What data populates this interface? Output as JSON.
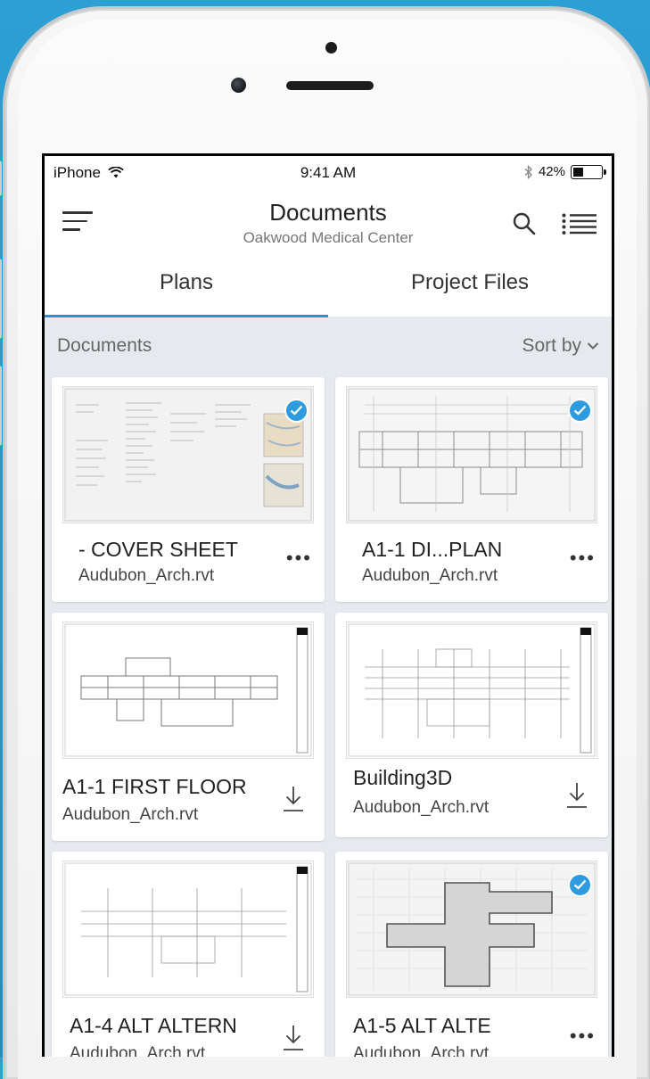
{
  "status_bar": {
    "carrier": "iPhone",
    "time": "9:41 AM",
    "battery": "42%",
    "battery_level": 0.42
  },
  "header": {
    "title": "Documents",
    "subtitle": "Oakwood Medical Center"
  },
  "tabs": [
    {
      "label": "Plans",
      "active": true
    },
    {
      "label": "Project Files",
      "active": false
    }
  ],
  "section": {
    "title": "Documents",
    "sort_label": "Sort by"
  },
  "cards": [
    {
      "name": "- COVER SHEET",
      "file": "Audubon_Arch.rvt",
      "action": "more",
      "checked": true
    },
    {
      "name": "A1-1 DI...PLAN",
      "file": "Audubon_Arch.rvt",
      "action": "more",
      "checked": true
    },
    {
      "name": "A1-1 FIRST FLOOR",
      "file": "Audubon_Arch.rvt",
      "action": "download",
      "checked": false
    },
    {
      "name": "Building3D",
      "file": "Audubon_Arch.rvt",
      "action": "download",
      "checked": false
    },
    {
      "name": "A1-4 ALT ALTERN",
      "file": "Audubon_Arch.rvt",
      "action": "download",
      "checked": false
    },
    {
      "name": "A1-5 ALT ALTE",
      "file": "Audubon_Arch.rvt",
      "action": "more",
      "checked": true
    }
  ],
  "icons": {
    "more": "more-icon",
    "download": "download-icon",
    "check": "synced-check-icon"
  },
  "colors": {
    "accent": "#2e8fd8",
    "background": "#2596cc"
  }
}
